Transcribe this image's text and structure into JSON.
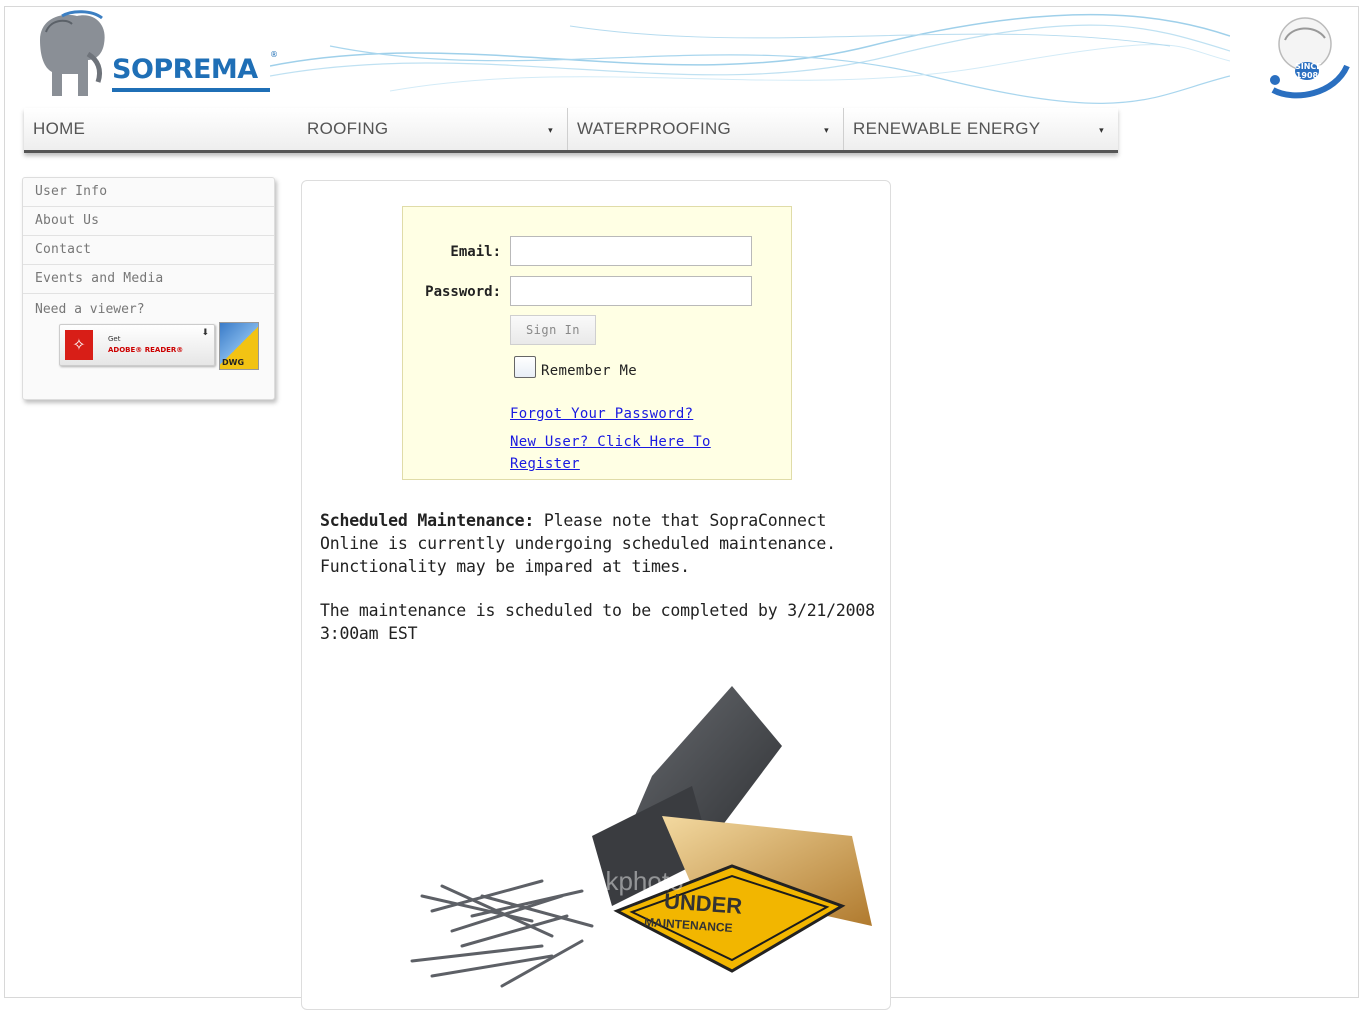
{
  "brand": {
    "name": "SOPREMA",
    "registered": "®",
    "seal_text": "SINCE 1908",
    "colors": {
      "brand_blue": "#1f6fb6",
      "link": "#1a1ae0",
      "login_bg": "#ffffe4"
    }
  },
  "nav": {
    "items": [
      {
        "label": "HOME",
        "has_dropdown": false
      },
      {
        "label": "ROOFING",
        "has_dropdown": true
      },
      {
        "label": "WATERPROOFING",
        "has_dropdown": true
      },
      {
        "label": "RENEWABLE ENERGY",
        "has_dropdown": true
      }
    ],
    "caret": "▾"
  },
  "sidebar": {
    "items": [
      {
        "label": "User Info"
      },
      {
        "label": "About Us"
      },
      {
        "label": "Contact"
      },
      {
        "label": "Events and Media"
      }
    ],
    "viewer_label": "Need a viewer?",
    "adobe": {
      "get": "Get",
      "name": "ADOBE® READER®",
      "download_glyph": "⬇"
    },
    "dwg": {
      "label": "DWG"
    }
  },
  "login": {
    "email_label": "Email:",
    "password_label": "Password:",
    "email_value": "",
    "password_value": "",
    "signin_label": "Sign In",
    "remember_label": "Remember Me",
    "forgot_link": "Forgot Your Password?",
    "register_link": "New User? Click Here To Register"
  },
  "notice": {
    "heading": "Scheduled Maintenance:",
    "body": "Please note that SopraConnect Online is currently undergoing scheduled maintenance. Functionality may be impared at times.",
    "completion": "The maintenance is scheduled to be completed by 3/21/2008 3:00am EST"
  },
  "illustration": {
    "sign_line1": "UNDER",
    "sign_line2": "MAINTENANCE",
    "watermark": "istockphoto"
  }
}
